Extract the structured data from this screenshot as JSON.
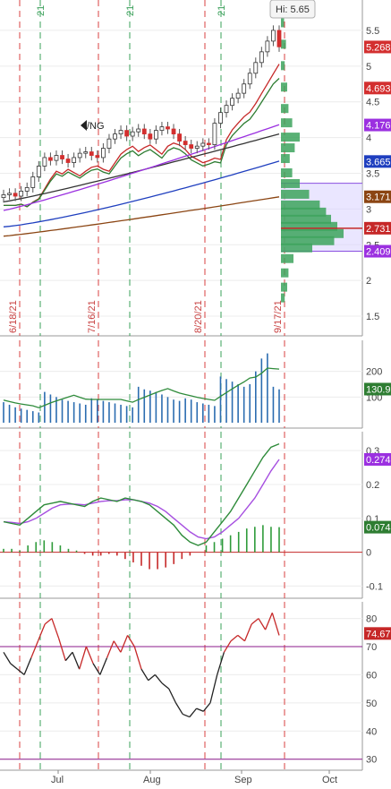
{
  "chart_data": [
    {
      "type": "candlestick",
      "panel": "price",
      "symbol_label": "/NG",
      "hi_label": "Hi: 5.65",
      "y_ticks": [
        "5.5",
        "5",
        "4.5",
        "4",
        "3.5",
        "3",
        "2.5",
        "2",
        "1.5"
      ],
      "ylim": [
        1.3,
        5.85
      ],
      "price_tags": [
        {
          "label": "5.268",
          "value": 5.268,
          "color": "#d32f2f"
        },
        {
          "label": "4.693",
          "value": 4.693,
          "color": "#d32f2f"
        },
        {
          "label": "4.176",
          "value": 4.176,
          "color": "#9b30e0"
        },
        {
          "label": "3.665",
          "value": 3.665,
          "color": "#1f3fbf"
        },
        {
          "label": "3.171",
          "value": 3.171,
          "color": "#8b4513"
        },
        {
          "label": "2.731",
          "value": 2.731,
          "color": "#c62828"
        },
        {
          "label": "2.409",
          "value": 2.409,
          "color": "#9b30e0"
        }
      ],
      "date_markers": [
        "6/18/21",
        "7/16/21",
        "8/20/21",
        "9/17/21"
      ],
      "top_markers": [
        "21",
        "21",
        "21"
      ],
      "closes": [
        3.2,
        3.22,
        3.18,
        3.25,
        3.3,
        3.45,
        3.6,
        3.72,
        3.68,
        3.75,
        3.7,
        3.65,
        3.72,
        3.78,
        3.8,
        3.75,
        3.72,
        3.85,
        3.98,
        4.05,
        4.1,
        4.02,
        4.08,
        4.12,
        4.05,
        3.98,
        4.1,
        4.15,
        4.12,
        4.05,
        3.95,
        3.9,
        3.85,
        3.88,
        3.92,
        3.9,
        4.2,
        4.35,
        4.45,
        4.55,
        4.62,
        4.75,
        4.9,
        5.05,
        5.2,
        5.35,
        5.5,
        5.27
      ],
      "moving_averages": [
        {
          "name": "ma_red",
          "color": "#c62828",
          "start": 3.05,
          "end": 4.69
        },
        {
          "name": "ma_green",
          "color": "#2e7d32",
          "start": 3.05,
          "end": 4.45
        },
        {
          "name": "ma_black",
          "color": "#333333",
          "start": 3.1,
          "end": 4.05
        },
        {
          "name": "ma_purple",
          "color": "#9b30e0",
          "start": 2.98,
          "end": 4.18
        },
        {
          "name": "ma_blue",
          "color": "#1f3fbf",
          "start": 2.75,
          "end": 3.67
        },
        {
          "name": "ma_brown",
          "color": "#8b4513",
          "start": 2.62,
          "end": 3.17
        }
      ],
      "volume_profile": [
        {
          "price": 5.6,
          "size": 0.05
        },
        {
          "price": 5.3,
          "size": 0.08
        },
        {
          "price": 5.0,
          "size": 0.06
        },
        {
          "price": 4.7,
          "size": 0.1
        },
        {
          "price": 4.4,
          "size": 0.12
        },
        {
          "price": 4.2,
          "size": 0.18
        },
        {
          "price": 4.0,
          "size": 0.3
        },
        {
          "price": 3.85,
          "size": 0.22
        },
        {
          "price": 3.7,
          "size": 0.14
        },
        {
          "price": 3.5,
          "size": 0.18
        },
        {
          "price": 3.35,
          "size": 0.3
        },
        {
          "price": 3.2,
          "size": 0.45
        },
        {
          "price": 3.05,
          "size": 0.62
        },
        {
          "price": 2.95,
          "size": 0.72
        },
        {
          "price": 2.85,
          "size": 0.8
        },
        {
          "price": 2.75,
          "size": 0.9
        },
        {
          "price": 2.65,
          "size": 1.0
        },
        {
          "price": 2.55,
          "size": 0.85
        },
        {
          "price": 2.45,
          "size": 0.5
        },
        {
          "price": 2.3,
          "size": 0.2
        },
        {
          "price": 2.1,
          "size": 0.12
        },
        {
          "price": 1.9,
          "size": 0.1
        },
        {
          "price": 1.75,
          "size": 0.06
        }
      ],
      "value_area": [
        2.409,
        3.36
      ]
    },
    {
      "type": "bar",
      "panel": "volume",
      "y_ticks": [
        "200",
        "100"
      ],
      "ylim": [
        0,
        300
      ],
      "last_label": "130.9",
      "last_color": "#2e7d32",
      "bars": [
        80,
        70,
        60,
        55,
        50,
        45,
        40,
        120,
        110,
        100,
        90,
        85,
        80,
        75,
        70,
        95,
        90,
        85,
        80,
        75,
        70,
        65,
        60,
        140,
        130,
        125,
        120,
        110,
        100,
        90,
        85,
        95,
        90,
        80,
        75,
        70,
        65,
        180,
        170,
        160,
        150,
        140,
        150,
        200,
        250,
        270,
        140,
        130
      ]
    },
    {
      "type": "line",
      "panel": "macd",
      "y_ticks": [
        "0.3",
        "0.2",
        "0.1",
        "0",
        "-0.1"
      ],
      "ylim": [
        -0.12,
        0.34
      ],
      "last_label": "0.274",
      "last_color": "#9b30e0",
      "hist_label": "0.074",
      "hist_color": "#2e7d32",
      "macd": [
        0.09,
        0.085,
        0.08,
        0.1,
        0.12,
        0.14,
        0.145,
        0.15,
        0.145,
        0.14,
        0.135,
        0.15,
        0.16,
        0.155,
        0.15,
        0.16,
        0.155,
        0.15,
        0.14,
        0.12,
        0.1,
        0.08,
        0.05,
        0.03,
        0.02,
        0.03,
        0.06,
        0.09,
        0.12,
        0.16,
        0.2,
        0.24,
        0.28,
        0.31,
        0.32
      ],
      "signal": [
        0.09,
        0.088,
        0.085,
        0.09,
        0.1,
        0.115,
        0.13,
        0.14,
        0.142,
        0.142,
        0.14,
        0.145,
        0.15,
        0.152,
        0.152,
        0.155,
        0.155,
        0.15,
        0.145,
        0.135,
        0.12,
        0.1,
        0.08,
        0.06,
        0.045,
        0.04,
        0.045,
        0.06,
        0.08,
        0.1,
        0.13,
        0.16,
        0.2,
        0.24,
        0.274
      ],
      "histogram": [
        0.01,
        0.01,
        0.005,
        0.02,
        0.03,
        0.035,
        0.03,
        0.02,
        0.01,
        0.005,
        -0.005,
        -0.01,
        -0.01,
        -0.005,
        -0.01,
        -0.02,
        -0.03,
        -0.04,
        -0.05,
        -0.05,
        -0.045,
        -0.035,
        -0.02,
        -0.01,
        0.0,
        0.02,
        0.03,
        0.04,
        0.05,
        0.06,
        0.07,
        0.075,
        0.08,
        0.075,
        0.074
      ]
    },
    {
      "type": "line",
      "panel": "rsi",
      "y_ticks": [
        "80",
        "70",
        "60",
        "50",
        "40",
        "30"
      ],
      "ylim": [
        28,
        84
      ],
      "last_label": "74.67",
      "last_color": "#c62828",
      "levels": [
        70,
        30
      ],
      "values": [
        68,
        64,
        62,
        60,
        66,
        72,
        78,
        80,
        73,
        65,
        68,
        62,
        70,
        64,
        60,
        66,
        72,
        68,
        74,
        70,
        62,
        58,
        60,
        57,
        55,
        50,
        46,
        45,
        48,
        47,
        50,
        60,
        68,
        72,
        74,
        72,
        78,
        80,
        76,
        82,
        74
      ]
    }
  ],
  "x_axis": {
    "labels": [
      "Jul",
      "Aug",
      "Sep",
      "Oct"
    ]
  }
}
